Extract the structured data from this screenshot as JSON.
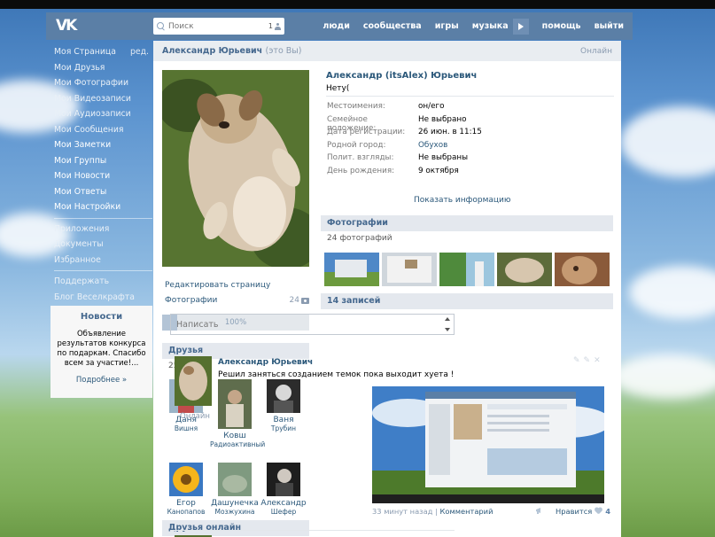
{
  "topbar": {
    "search_placeholder": "Поиск",
    "search_count": "1",
    "nav": [
      "люди",
      "сообщества",
      "игры",
      "музыка",
      "помощь",
      "выйти"
    ]
  },
  "sidebar": {
    "edit_label": "ред.",
    "items": [
      "Моя Страница",
      "Мои Друзья",
      "Мои Фотографии",
      "Мои Видеозаписи",
      "Мои Аудиозаписи",
      "Мои Сообщения",
      "Мои Заметки",
      "Мои Группы",
      "Мои Новости",
      "Мои Ответы",
      "Мои Настройки"
    ],
    "items2": [
      "Приложения",
      "Документы",
      "Избранное"
    ],
    "items3": [
      "Поддержать",
      "Блог Веселкрафта"
    ]
  },
  "news": {
    "title": "Новости",
    "text": "Объявление результатов конкурса по подаркам. Спасибо всем за участие!...",
    "more": "Подробнее »"
  },
  "header": {
    "name": "Александр Юрьевич",
    "you": "(это Вы)",
    "online": "Онлайн"
  },
  "left": {
    "edit_page": "Редактировать страницу",
    "photos_label": "Фотографии",
    "photos_count": "24",
    "progress_text": "100%",
    "progress_value": 0.1
  },
  "friends": {
    "title": "Друзья",
    "count": "25 друзей",
    "list": [
      {
        "first": "Даня",
        "last": "Вишня"
      },
      {
        "first": "Ковш",
        "last": "Радиоактивный"
      },
      {
        "first": "Ваня",
        "last": "Трубин"
      },
      {
        "first": "Егор",
        "last": "Канопапов"
      },
      {
        "first": "Дашунечка",
        "last": "Мозжухина"
      },
      {
        "first": "Александр",
        "last": "Шефер"
      }
    ],
    "online_title": "Друзья онлайн"
  },
  "profile": {
    "name": "Александр (itsAlex) Юрьевич",
    "status": "Нету(",
    "info": [
      {
        "k": "Местоимения:",
        "v": "он/его",
        "link": false
      },
      {
        "k": "Семейное положение:",
        "v": "Не выбрано",
        "link": false
      },
      {
        "k": "Дата регистрации:",
        "v": "26 июн. в 11:15",
        "link": false
      },
      {
        "k": "Родной город:",
        "v": "Обухов",
        "link": true
      },
      {
        "k": "Полит. взгляды:",
        "v": "Не выбраны",
        "link": false
      },
      {
        "k": "День рождения:",
        "v": "9 октября",
        "link": false
      }
    ],
    "show_info": "Показать информацию"
  },
  "photos": {
    "title": "Фотографии",
    "count": "24 фотографий"
  },
  "wall": {
    "title": "14 записей",
    "input_placeholder": "Написать"
  },
  "post": {
    "author": "Александр Юрьевич",
    "text": "Решил заняться созданием темок пока выходит хуета !",
    "online": "Онлайн",
    "time": "33 минут назад",
    "separator": "|",
    "comment": "Комментарий",
    "like_label": "Нравится",
    "like_count": "4"
  }
}
